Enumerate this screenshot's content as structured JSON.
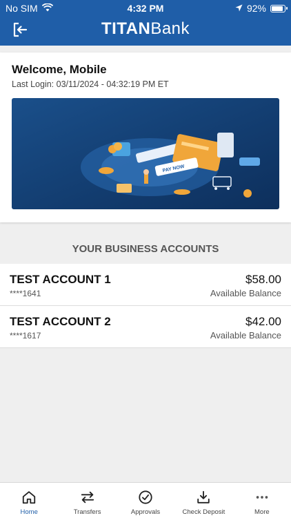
{
  "status_bar": {
    "carrier": "No SIM",
    "time": "4:32 PM",
    "battery": "92%",
    "battery_level": 0.92
  },
  "header": {
    "brand_strong": "TITAN",
    "brand_light": "Bank"
  },
  "welcome": {
    "title": "Welcome, Mobile",
    "last_login": "Last Login: 03/11/2024 - 04:32:19 PM ET"
  },
  "banner": {
    "sign_text": "PAY NOW"
  },
  "section_title": "YOUR BUSINESS ACCOUNTS",
  "accounts": [
    {
      "name": "TEST ACCOUNT 1",
      "number": "****1641",
      "balance": "$58.00",
      "balance_label": "Available Balance"
    },
    {
      "name": "TEST ACCOUNT 2",
      "number": "****1617",
      "balance": "$42.00",
      "balance_label": "Available Balance"
    }
  ],
  "tabs": [
    {
      "label": "Home",
      "icon": "home-icon",
      "active": true
    },
    {
      "label": "Transfers",
      "icon": "transfer-arrows-icon",
      "active": false
    },
    {
      "label": "Approvals",
      "icon": "check-circle-icon",
      "active": false
    },
    {
      "label": "Check Deposit",
      "icon": "download-icon",
      "active": false
    },
    {
      "label": "More",
      "icon": "more-dots-icon",
      "active": false
    }
  ],
  "colors": {
    "primary": "#1f5ea8",
    "background": "#efefef"
  }
}
